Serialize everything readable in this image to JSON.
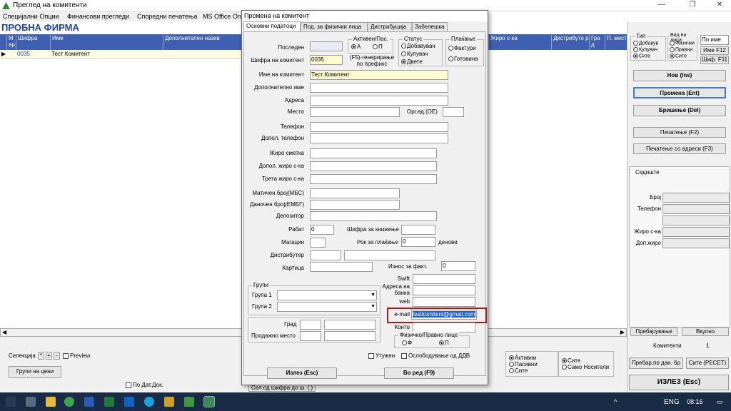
{
  "window": {
    "title": "Преглед на комитенти",
    "min": "—",
    "max": "❐",
    "close": "✕"
  },
  "menu": [
    "Специјални Опции",
    "Финансови прегледи",
    "Споредни печатења",
    "MS Office On"
  ],
  "firm": "ПРОБНА ФИРМА",
  "grid": {
    "headers": [
      "М ар",
      "Шифра",
      "Име",
      "Дополнителен назив",
      "Жиро с-ка",
      "Дистрибуте р",
      "Гра д",
      "П. мест"
    ],
    "row": {
      "pointer": "▶",
      "code": "0035",
      "name": "Тест Комитент"
    }
  },
  "bottom": {
    "selection_label": "Селекција",
    "sel_buttons": [
      "*",
      "+",
      "-"
    ],
    "preview": "Preview",
    "groups_btn": "Групи на цени",
    "po_dat": "По Дат.Док.",
    "sel_code_btn": "Сел.од шифра до ш. (,)",
    "r1": [
      "Активни",
      "Пасивни",
      "Сите"
    ],
    "r2": [
      "Сите",
      "Само Носители"
    ]
  },
  "right": {
    "type_title": "Тип",
    "type_opts": [
      "Добавув",
      "Купувач",
      "Сите"
    ],
    "legal_title": "Вид на лица",
    "legal_opts": [
      "Физички",
      "Правни",
      "Сите"
    ],
    "search_opt": "По име",
    "name_btn": "Име F12",
    "code_btn": "Шиф. F11",
    "new_btn": "Нов (Ins)",
    "edit_btn": "Промена (Ent)",
    "delete_btn": "Бришење (Del)",
    "print_btn": "Печатење (F2)",
    "print_addr_btn": "Печатење со адреси (F3)",
    "seat_title": "Седиште",
    "seat_fields": [
      "Број",
      "Телефон",
      "",
      "Жиро с-ка",
      "Доп.жиро"
    ],
    "search_btn": "Пребарување",
    "total_btn": "Вкупно",
    "count_label": "Комитенти",
    "count": "1",
    "search_bank_btn": "Пребар.по дан. бр",
    "all_reset_btn": "Сите (РЕСЕТ)",
    "exit_btn": "ИЗЛЕЗ (Esc)"
  },
  "dialog": {
    "title": "Промена на комитент",
    "tabs": [
      "Основни подaтоци",
      "Под. за физички лица",
      "Дистрибуција",
      "Забелешка"
    ],
    "last_label": "Последен",
    "code_label": "Шифра на комитент",
    "code_value": "0035",
    "active_title": "Активен/Пас.",
    "active_opts": [
      "А",
      "П"
    ],
    "hint": "(F5)-генерирање по префикс",
    "status_title": "Статус",
    "status_opts": [
      "Добавувач",
      "Купувач",
      "Двете"
    ],
    "pay_title": "Плаќање",
    "pay_opts": [
      "Фактури",
      "Готовина"
    ],
    "name_label": "Име на комитент",
    "name_value": "Тест Комитент",
    "extra_name": "Дополнително име",
    "address": "Адреса",
    "place": "Место",
    "org_unit": "Орг.ед.(ОЕ)",
    "phone": "Телефон",
    "add_phone": "Допол. телефон",
    "account": "Жиро сметка",
    "add_account": "Допол. жиро с-ка",
    "third_account": "Трета жиро с-ка",
    "mbs": "Матичен број(МБС)",
    "tax": "Даночен број(ЕМБГ)",
    "depositor": "Депозитор",
    "discount": "Рабат",
    "discount_value": "0",
    "booking_code": "Шифра за книжење",
    "warehouse": "Магацин",
    "pay_term": "Рок за плаќање",
    "pay_term_value": "0",
    "days": "денови",
    "distributor": "Дистрибутер",
    "card": "Картица",
    "invoice_amount": "Износ за факт.",
    "invoice_value": "0",
    "swift": "Swift",
    "bank_addr": "Адреса на банка",
    "web": "web",
    "groups_title": "Групи",
    "group1": "Група 1",
    "group2": "Група 2",
    "city": "Град",
    "shop": "Продажно место",
    "email_label": "e-mail",
    "email_value": "testkomitent@gmail.com",
    "konto": "Конто",
    "fp_title": "Физичко/Правно лице",
    "fp_opts": [
      "Ф",
      "П"
    ],
    "sued": "Утужен",
    "vat_free": "Ослободување од ДДВ",
    "exit_btn": "Излез (Esc)",
    "ok_btn": "Во ред (F9)"
  },
  "tray": {
    "lang": "ENG",
    "time": "08:16"
  }
}
